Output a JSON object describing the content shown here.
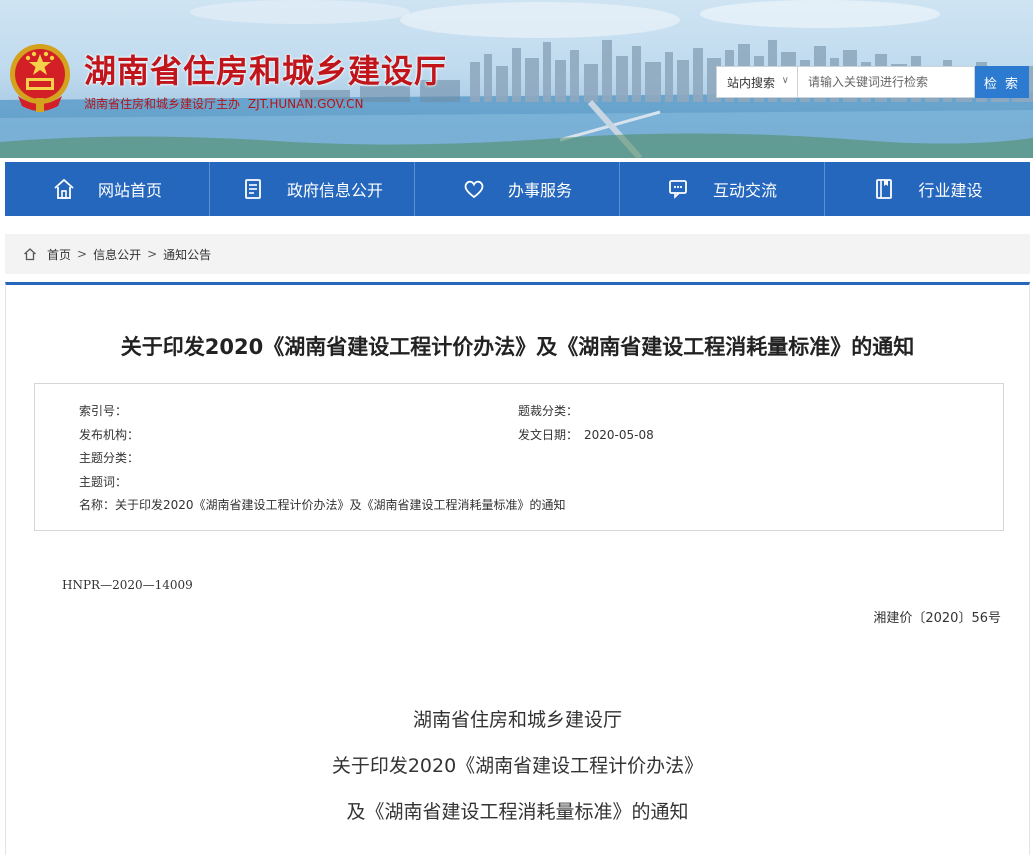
{
  "header": {
    "title": "湖南省住房和城乡建设厅",
    "subtitle": "湖南省住房和城乡建设厅主办",
    "domain": "ZJT.HUNAN.GOV.CN"
  },
  "search": {
    "scope": "站内搜索",
    "placeholder": "请输入关键词进行检索",
    "button": "检 索"
  },
  "nav": {
    "items": [
      {
        "label": "网站首页",
        "icon": "home-icon"
      },
      {
        "label": "政府信息公开",
        "icon": "document-icon"
      },
      {
        "label": "办事服务",
        "icon": "heart-icon"
      },
      {
        "label": "互动交流",
        "icon": "chat-icon"
      },
      {
        "label": "行业建设",
        "icon": "book-icon"
      }
    ]
  },
  "breadcrumb": {
    "items": [
      "首页",
      "信息公开",
      "通知公告"
    ],
    "separator": ">"
  },
  "article": {
    "title": "关于印发2020《湖南省建设工程计价办法》及《湖南省建设工程消耗量标准》的通知",
    "meta": {
      "index_label": "索引号：",
      "index_value": "",
      "topic_label": "题裁分类：",
      "topic_value": "",
      "publisher_label": "发布机构：",
      "publisher_value": "",
      "date_label": "发文日期：",
      "date_value": "2020-05-08",
      "subject_label": "主题分类：",
      "subject_value": "",
      "keywords_label": "主题词：",
      "keywords_value": "",
      "name_label": "名称：",
      "name_value": "关于印发2020《湖南省建设工程计价办法》及《湖南省建设工程消耗量标准》的通知"
    },
    "doc_number": "HNPR—2020—14009",
    "doc_ref": "湘建价〔2020〕56号",
    "body_lines": [
      "湖南省住房和城乡建设厅",
      "关于印发2020《湖南省建设工程计价办法》",
      "及《湖南省建设工程消耗量标准》的通知"
    ]
  },
  "colors": {
    "nav_bg": "#2467bd",
    "title_red": "#c0151b",
    "search_button": "#2d7bd0"
  }
}
